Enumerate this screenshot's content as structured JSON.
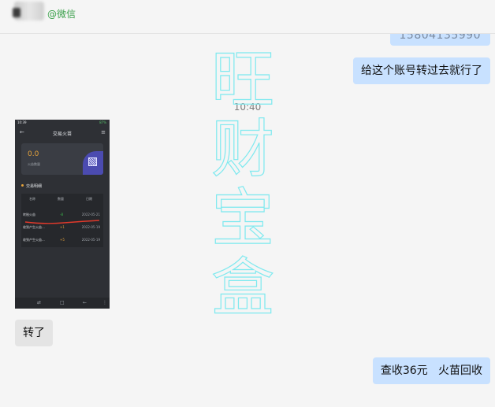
{
  "header": {
    "contact_tag": "@微信"
  },
  "messages": {
    "partial_top": "15804135990",
    "msg1": "给这个账号转过去就行了",
    "timestamp": "10:40",
    "reply_left": "转了",
    "msg_last": "查收36元   火苗回收"
  },
  "watermark": {
    "chars": [
      "旺",
      "财",
      "宝",
      "盒"
    ]
  },
  "screenshot": {
    "status_time": "10:39",
    "status_right": "87%",
    "title": "交易火苗",
    "balance": "0.0",
    "balance_label": "火苗数量",
    "section_title": "交易明细",
    "columns": [
      "名称",
      "数量",
      "日期"
    ],
    "rows": [
      {
        "name": "转账火苗",
        "qty": "-8",
        "date": "2022-05-21"
      },
      {
        "name": "收到产生火苗...",
        "qty": "+1",
        "date": "2022-05-19"
      },
      {
        "name": "收到产生火苗...",
        "qty": "+5",
        "date": "2022-05-19"
      }
    ]
  },
  "colors": {
    "right_bubble": "#c8e1ff",
    "left_bubble": "#e4e4e4",
    "watermark_stroke": "#7fe9ef",
    "tag_green": "#3aa04a"
  }
}
